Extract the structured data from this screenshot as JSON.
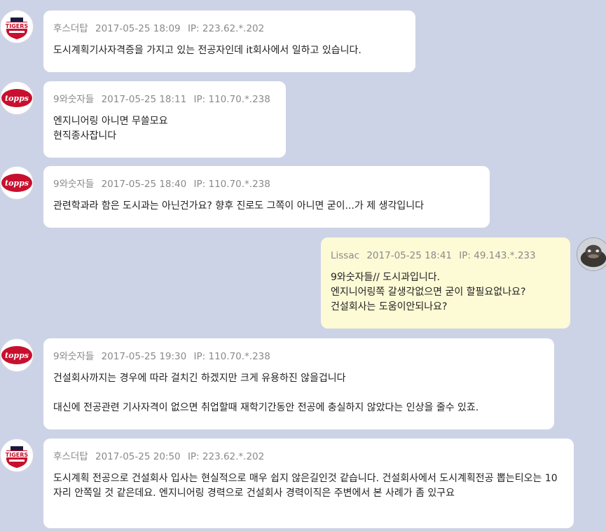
{
  "colors": {
    "background": "#cdd3e6",
    "bubble_other": "#ffffff",
    "bubble_mine": "#fdfad6",
    "meta_text": "#8a8a8a",
    "body_text": "#222222",
    "tigers_red": "#c8102e",
    "topps_red": "#c8102e"
  },
  "messages": [
    {
      "author": "후스더탑",
      "timestamp": "2017-05-25 18:09",
      "ip": "IP: 223.62.*.202",
      "avatar_icon": "tigers-logo-icon",
      "lines": [
        "도시계획기사자격증을 가지고 있는 전공자인데 it회사에서 일하고 있습니다."
      ]
    },
    {
      "author": "9와숫자들",
      "timestamp": "2017-05-25 18:11",
      "ip": "IP: 110.70.*.238",
      "avatar_icon": "topps-logo-icon",
      "lines": [
        "엔지니어링 아니면 무쓸모요",
        "현직종사잡니다"
      ]
    },
    {
      "author": "9와숫자들",
      "timestamp": "2017-05-25 18:40",
      "ip": "IP: 110.70.*.238",
      "avatar_icon": "topps-logo-icon",
      "lines": [
        "관련학과라 함은 도시과는 아닌건가요? 향후 진로도 그쪽이 아니면 굳이...가 제 생각입니다"
      ]
    },
    {
      "author": "Lissac",
      "timestamp": "2017-05-25 18:41",
      "ip": "IP: 49.143.*.233",
      "avatar_icon": "user-photo-icon",
      "lines": [
        "9와숫자들// 도시과입니다.",
        "엔지니어링쪽 갈생각없으면 굳이 할필요없나요?",
        "건설회사는 도움이안되나요?"
      ]
    },
    {
      "author": "9와숫자들",
      "timestamp": "2017-05-25 19:30",
      "ip": "IP: 110.70.*.238",
      "avatar_icon": "topps-logo-icon",
      "lines": [
        "건설회사까지는 경우에 따라 걸치긴 하겠지만 크게 유용하진 않을겁니다",
        "",
        "대신에 전공관련 기사자격이 없으면 취업할때 재학기간동안 전공에 충실하지 않았다는 인상을 줄수 있죠."
      ]
    },
    {
      "author": "후스더탑",
      "timestamp": "2017-05-25 20:50",
      "ip": "IP: 223.62.*.202",
      "avatar_icon": "tigers-logo-icon",
      "lines": [
        "도시계획 전공으로 건설회사 입사는 현실적으로 매우 쉽지 않은길인것 같습니다. 건설회사에서 도시계획전공 뽑는티오는 10자리 안쪽일 것 같은데요. 엔지니어링 경력으로 건설회사 경력이직은 주변에서 본 사례가 좀 있구요"
      ]
    }
  ]
}
